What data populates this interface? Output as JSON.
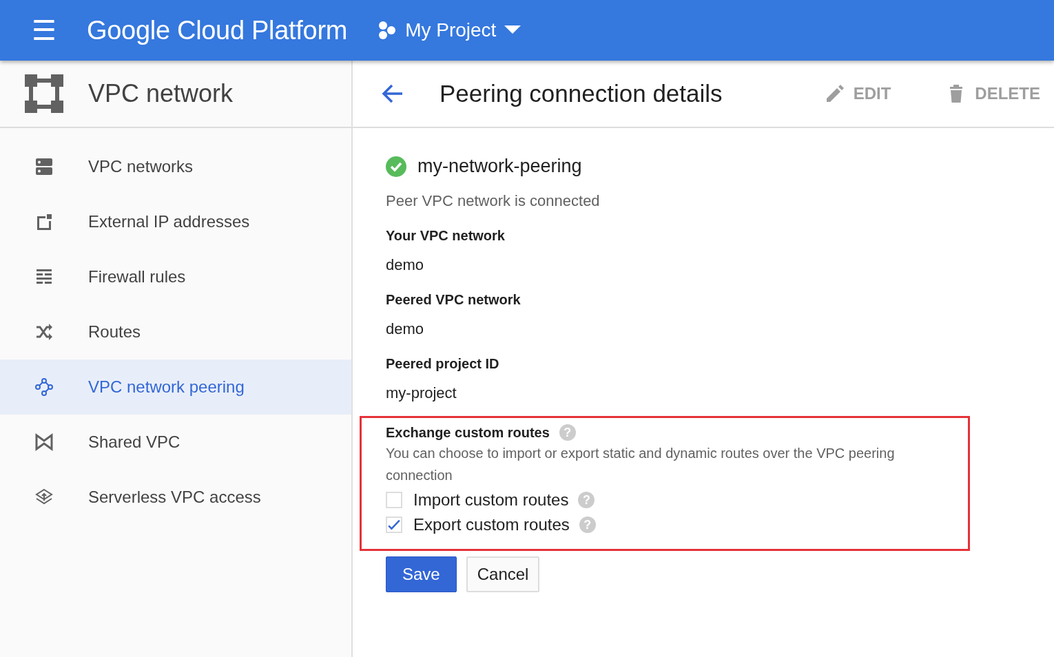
{
  "topbar": {
    "menu_icon": "☰",
    "brand": "Google Cloud Platform",
    "project": "My Project"
  },
  "sidebar": {
    "title": "VPC network",
    "items": [
      {
        "label": "VPC networks",
        "selected": false
      },
      {
        "label": "External IP addresses",
        "selected": false
      },
      {
        "label": "Firewall rules",
        "selected": false
      },
      {
        "label": "Routes",
        "selected": false
      },
      {
        "label": "VPC network peering",
        "selected": true
      },
      {
        "label": "Shared VPC",
        "selected": false
      },
      {
        "label": "Serverless VPC access",
        "selected": false
      }
    ]
  },
  "page": {
    "title": "Peering connection details",
    "actions": [
      {
        "label": "EDIT",
        "kind": "edit",
        "disabled": true
      },
      {
        "label": "DELETE",
        "kind": "delete",
        "disabled": true
      }
    ]
  },
  "peering": {
    "name": "my-network-peering",
    "connected": true,
    "status": "Peer VPC network is connected",
    "fields": [
      {
        "label": "Your VPC network",
        "value": "demo"
      },
      {
        "label": "Peered VPC network",
        "value": "demo"
      },
      {
        "label": "Peered project ID",
        "value": "my-project"
      }
    ],
    "exchange": {
      "title": "Exchange custom routes",
      "help_icon": "?",
      "description": "You can choose to import or export static and dynamic routes over the VPC peering connection",
      "options": [
        {
          "label": "Import custom routes",
          "checked": false,
          "help_icon": "?"
        },
        {
          "label": "Export custom routes",
          "checked": true,
          "help_icon": "?"
        }
      ]
    }
  },
  "buttons": [
    {
      "label": "Save",
      "kind": "primary"
    },
    {
      "label": "Cancel",
      "kind": "secondary"
    }
  ]
}
